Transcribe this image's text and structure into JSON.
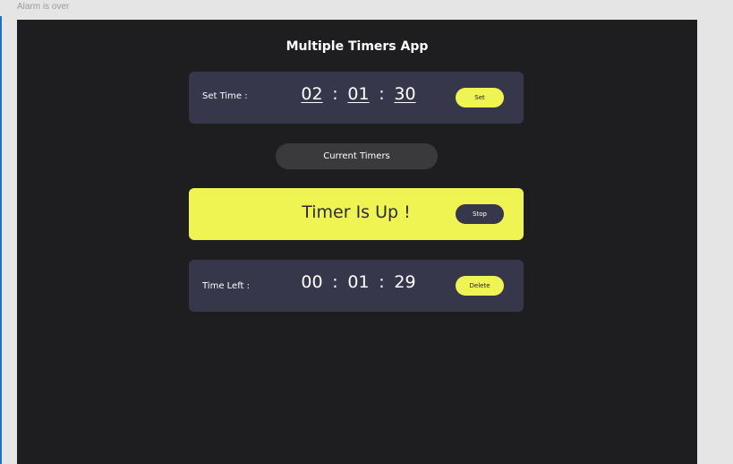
{
  "frame_label": "Alarm is over",
  "app": {
    "title": "Multiple Timers App"
  },
  "set_time": {
    "label": "Set Time :",
    "hours": "02",
    "minutes": "01",
    "seconds": "30",
    "separator": ":",
    "button_label": "Set"
  },
  "current_timers_label": "Current Timers",
  "alert": {
    "text": "Timer Is Up !",
    "button_label": "Stop"
  },
  "timer": {
    "label": "Time Left :",
    "hours": "00",
    "minutes": "01",
    "seconds": "29",
    "separator": ":",
    "button_label": "Delete"
  },
  "colors": {
    "background": "#1e1e21",
    "card": "#37374b",
    "accent": "#f0f452",
    "pill": "#3a3a3c"
  }
}
